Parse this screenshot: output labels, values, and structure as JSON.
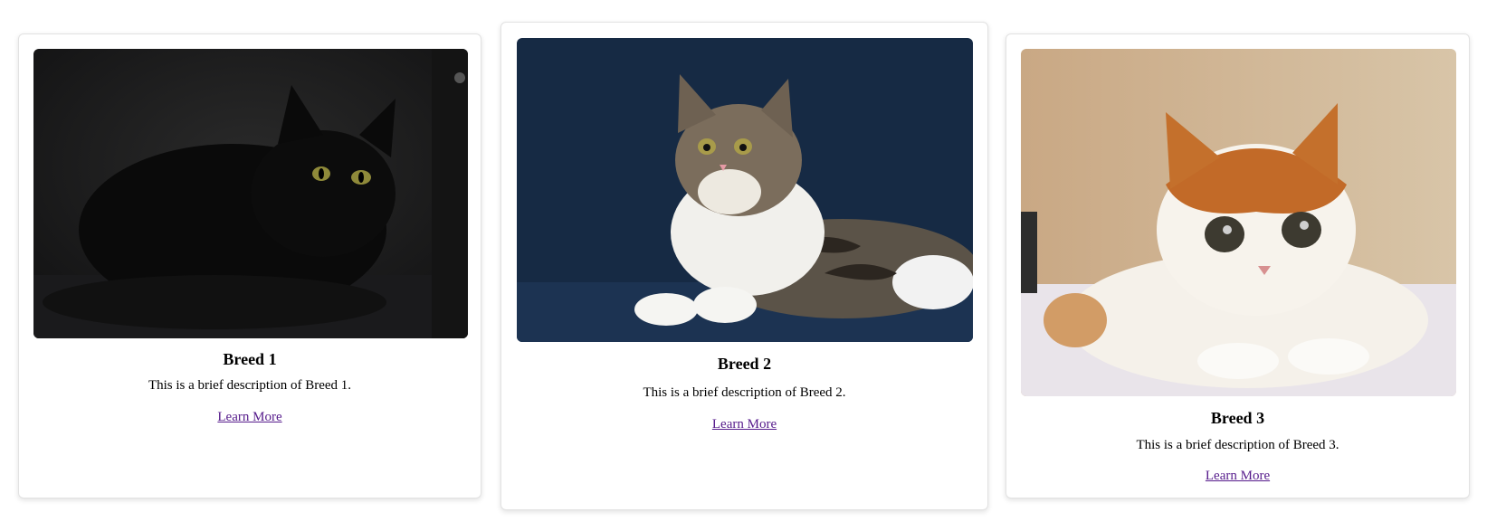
{
  "cards": [
    {
      "image_alt": "black cat lying on a dark sofa",
      "title": "Breed 1",
      "description": "This is a brief description of Breed 1.",
      "link_label": "Learn More"
    },
    {
      "image_alt": "long-haired tabby and white cat lying on a navy sofa",
      "title": "Breed 2",
      "description": "This is a brief description of Breed 2.",
      "link_label": "Learn More"
    },
    {
      "image_alt": "orange and white cat lying on a blanket",
      "title": "Breed 3",
      "description": "This is a brief description of Breed 3.",
      "link_label": "Learn More"
    }
  ],
  "colors": {
    "link": "#551a8b",
    "card_border": "#e2e2e2"
  }
}
